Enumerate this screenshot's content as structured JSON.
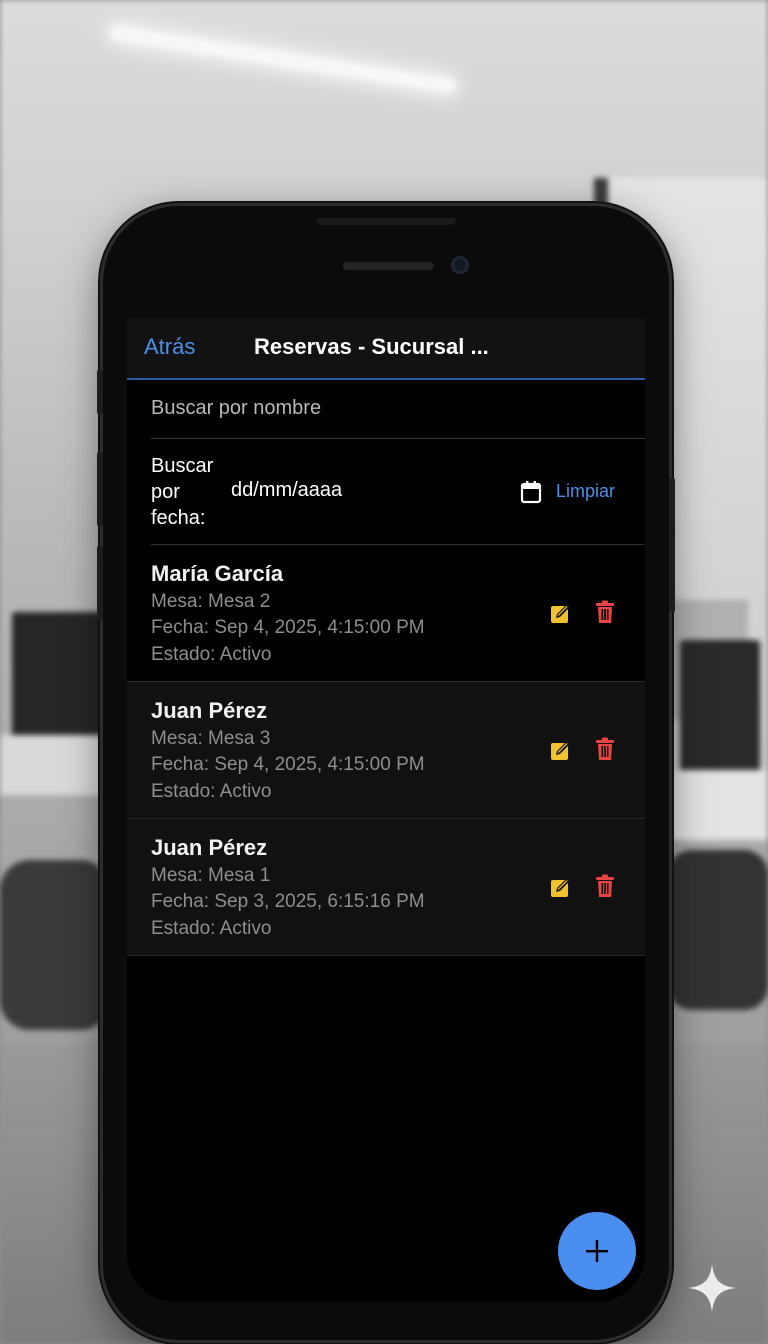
{
  "navbar": {
    "back_label": "Atrás",
    "title": "Reservas - Sucursal ..."
  },
  "search": {
    "placeholder": "Buscar por nombre",
    "value": ""
  },
  "date_filter": {
    "label": "Buscar\npor\nfecha:",
    "value": "dd/mm/aaaa",
    "calendar_icon": "calendar-icon",
    "clear_label": "Limpiar"
  },
  "reservations": [
    {
      "name": "María García",
      "mesa": "Mesa: Mesa 2",
      "fecha": "Fecha: Sep 4, 2025, 4:15:00 PM",
      "estado": "Estado: Activo"
    },
    {
      "name": "Juan Pérez",
      "mesa": "Mesa: Mesa 3",
      "fecha": "Fecha: Sep 4, 2025, 4:15:00 PM",
      "estado": "Estado: Activo"
    },
    {
      "name": "Juan Pérez",
      "mesa": "Mesa: Mesa 1",
      "fecha": "Fecha: Sep 3, 2025, 6:15:16 PM",
      "estado": "Estado: Activo"
    }
  ],
  "icons": {
    "edit": "edit-icon",
    "delete": "trash-icon",
    "add": "plus-icon"
  },
  "colors": {
    "accent": "#4d8fe8",
    "edit": "#f2c230",
    "delete": "#e84444",
    "fab": "#4a8ef0"
  }
}
